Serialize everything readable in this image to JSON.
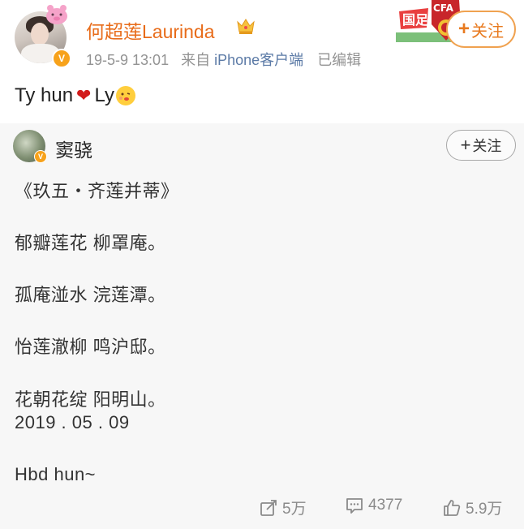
{
  "post": {
    "username": "何超莲Laurinda",
    "date": "19-5-9 13:01",
    "source_prefix": "来自",
    "source": "iPhone客户端",
    "edited": "已编辑",
    "follow_label": "关注",
    "text_before": "Ty hun",
    "text_after": "Ly"
  },
  "retweet": {
    "username": "窦骁",
    "follow_label": "关注",
    "lines": [
      "《玖五・齐莲并蒂》",
      "郁瓣莲花 柳罩庵。",
      "孤庵湴水 浣莲潭。",
      "怡莲澈柳 鸣沪邸。",
      "花朝花绽 阳明山。",
      "2019 . 05 . 09",
      "Hbd hun~"
    ]
  },
  "stats": {
    "reposts": "5万",
    "comments": "4377",
    "likes": "5.9万"
  },
  "colors": {
    "username": "#e86c1a",
    "link": "#5b7aa6",
    "meta": "#939393",
    "follow_border": "#f0a250",
    "verified": "#f7a21b"
  }
}
